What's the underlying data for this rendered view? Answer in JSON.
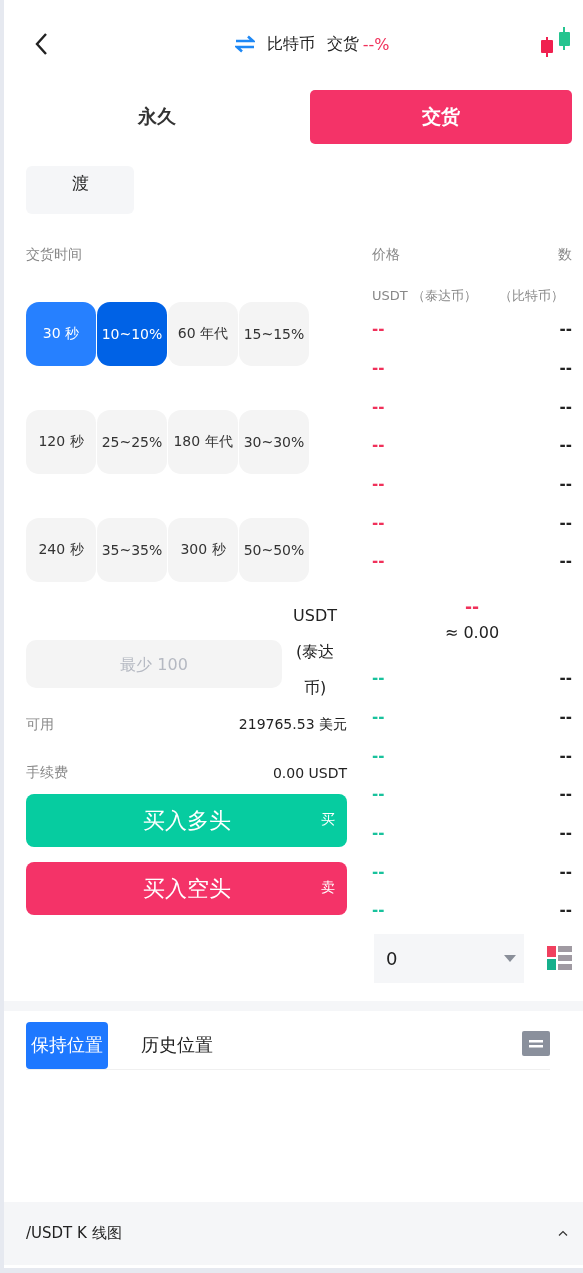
{
  "header": {
    "title": "比特币",
    "mode": "交货",
    "change": "--%"
  },
  "tabs": [
    {
      "label": "永久",
      "selected": false
    },
    {
      "label": "交货",
      "selected": true
    }
  ],
  "chip": "渡",
  "delivery_time_label": "交货时间",
  "options": [
    {
      "time": "30 秒",
      "rate": "10~10%",
      "selected": true
    },
    {
      "time": "60 年代",
      "rate": "15~15%",
      "selected": false
    },
    {
      "time": "120 秒",
      "rate": "25~25%",
      "selected": false
    },
    {
      "time": "180 年代",
      "rate": "30~30%",
      "selected": false
    },
    {
      "time": "240 秒",
      "rate": "35~35%",
      "selected": false
    },
    {
      "time": "300 秒",
      "rate": "50~50%",
      "selected": false
    }
  ],
  "amount": {
    "placeholder": "最少 100",
    "unit": "USDT (泰达币)"
  },
  "available": {
    "label": "可用",
    "value": "219765.53 美元"
  },
  "fee": {
    "label": "手续费",
    "value": "0.00 USDT"
  },
  "buy_button": {
    "label": "买入多头",
    "tag": "买"
  },
  "sell_button": {
    "label": "买入空头",
    "tag": "卖"
  },
  "order_book": {
    "price_header": "价格",
    "amount_header": "数",
    "price_unit": "USDT （泰达币）",
    "amount_unit": "（比特币）",
    "asks": [
      {
        "price": "--",
        "amount": "--"
      },
      {
        "price": "--",
        "amount": "--"
      },
      {
        "price": "--",
        "amount": "--"
      },
      {
        "price": "--",
        "amount": "--"
      },
      {
        "price": "--",
        "amount": "--"
      },
      {
        "price": "--",
        "amount": "--"
      },
      {
        "price": "--",
        "amount": "--"
      }
    ],
    "last_price": "--",
    "approx": "≈ 0.00",
    "bids": [
      {
        "price": "--",
        "amount": "--"
      },
      {
        "price": "--",
        "amount": "--"
      },
      {
        "price": "--",
        "amount": "--"
      },
      {
        "price": "--",
        "amount": "--"
      },
      {
        "price": "--",
        "amount": "--"
      },
      {
        "price": "--",
        "amount": "--"
      },
      {
        "price": "--",
        "amount": "--"
      }
    ],
    "depth_select": "0"
  },
  "position_tabs": [
    {
      "label": "保持位置",
      "selected": true
    },
    {
      "label": "历史位置",
      "selected": false
    }
  ],
  "footer": {
    "label": "/USDT K 线图"
  }
}
